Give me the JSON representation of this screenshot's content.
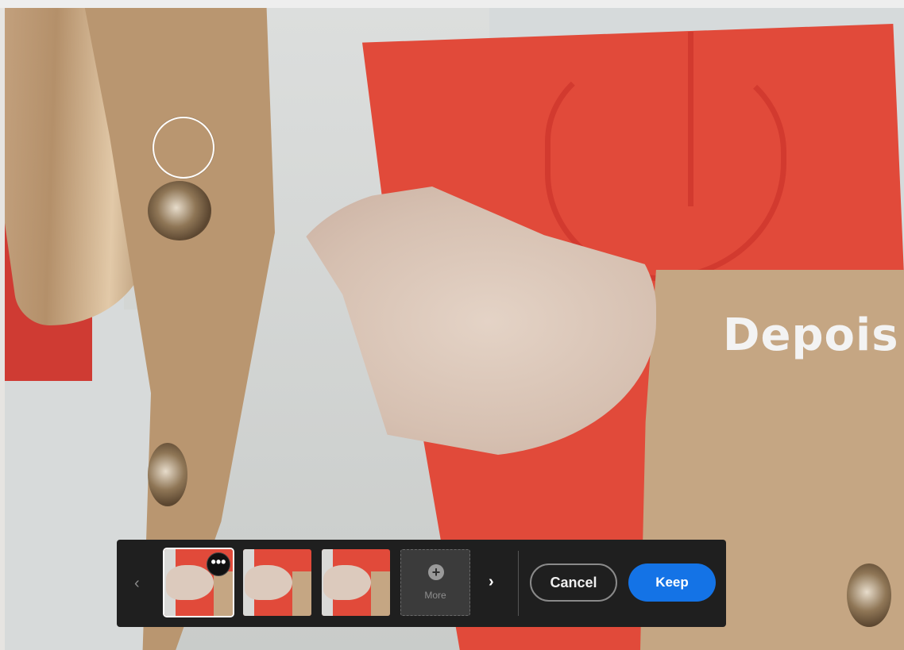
{
  "overlay": {
    "label": "Depois"
  },
  "toolbar": {
    "prev_icon": "chevron-left-icon",
    "next_icon": "chevron-right-icon",
    "prev_glyph": "‹",
    "next_glyph": "›",
    "thumbnail_menu_glyph": "•••",
    "more_label": "More",
    "more_glyph": "+",
    "cancel_label": "Cancel",
    "keep_label": "Keep",
    "keep_color": "#1473e6"
  }
}
